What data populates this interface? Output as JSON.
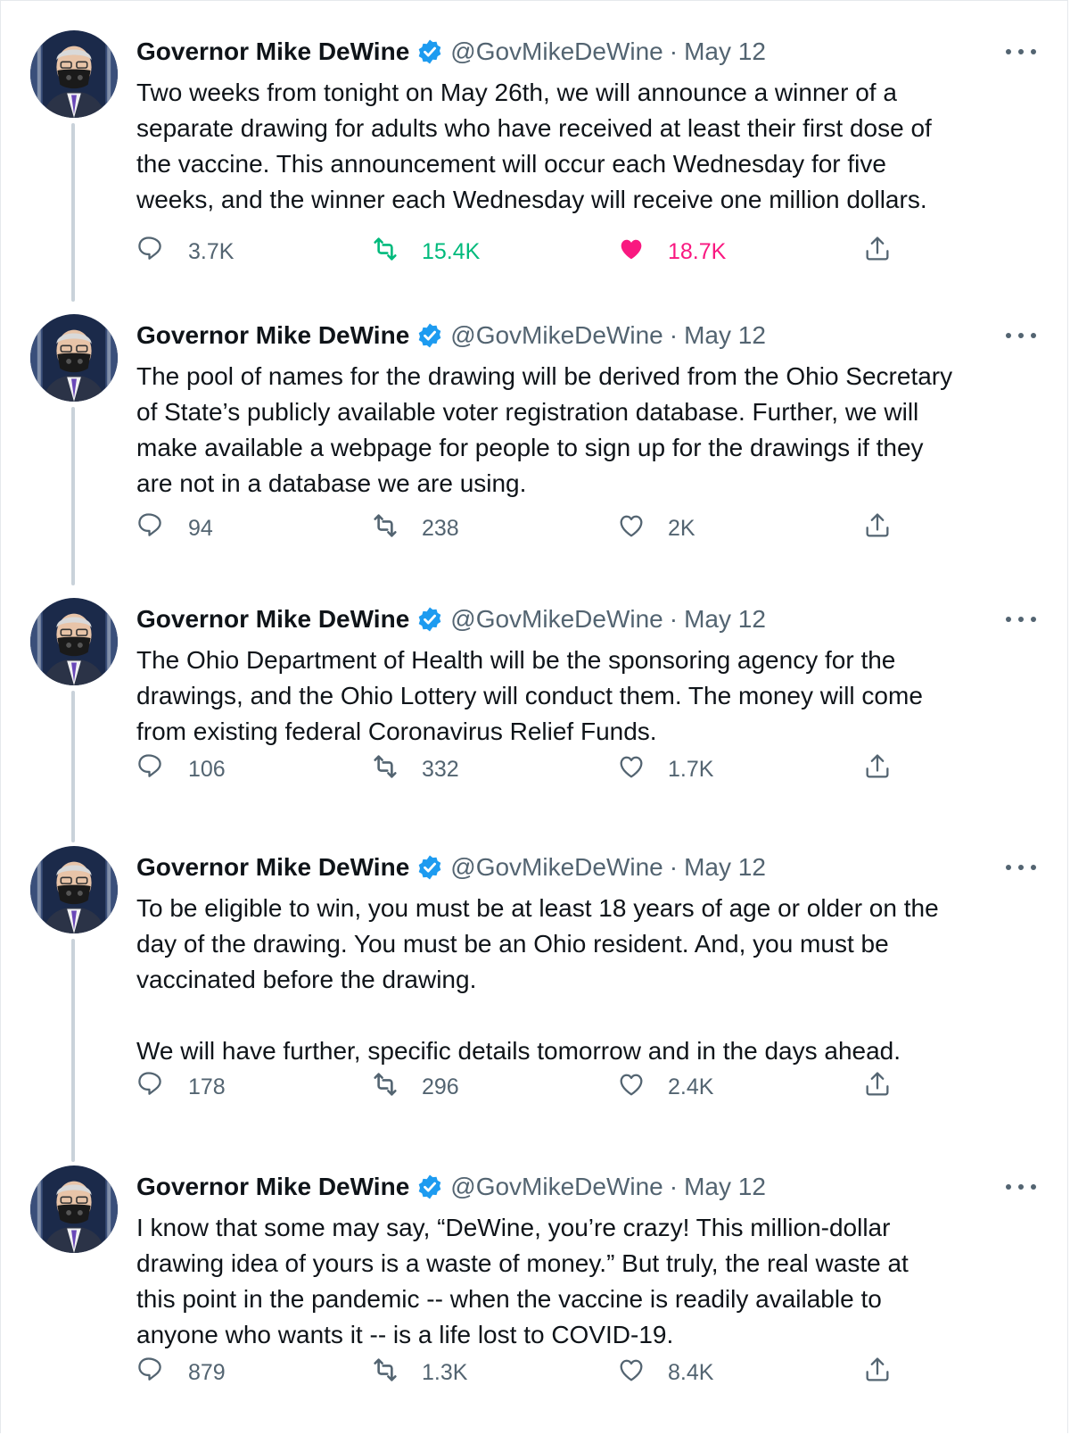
{
  "author": {
    "name": "Governor Mike DeWine",
    "handle": "@GovMikeDeWine",
    "separator": "·"
  },
  "colors": {
    "verified": "#1d9bf0",
    "retweeted": "#00ba7c",
    "liked": "#f91880",
    "muted": "#536471",
    "thread_line": "#c9d2da"
  },
  "tweets": [
    {
      "date": "May 12",
      "text": "Two weeks from tonight on May 26th, we will announce a winner of a\nseparate drawing for adults who have received at least their first dose of\nthe vaccine.  This announcement will occur each Wednesday for five\nweeks, and the winner each Wednesday will receive one million dollars.",
      "replies": "3.7K",
      "retweets": "15.4K",
      "likes": "18.7K",
      "retweeted": true,
      "liked": true
    },
    {
      "date": "May 12",
      "text": "The pool of names for the drawing will be derived from the Ohio Secretary\nof State’s publicly available voter registration database.  Further, we will\nmake available a webpage for people to sign up for the drawings if they\nare not in a database we are using.",
      "replies": "94",
      "retweets": "238",
      "likes": "2K",
      "retweeted": false,
      "liked": false
    },
    {
      "date": "May 12",
      "text": "The Ohio Department of Health will be the sponsoring agency for the\ndrawings, and the Ohio Lottery will conduct them.  The money will come\nfrom existing federal Coronavirus Relief Funds.",
      "replies": "106",
      "retweets": "332",
      "likes": "1.7K",
      "retweeted": false,
      "liked": false
    },
    {
      "date": "May 12",
      "text": "To be eligible to win, you must be at least 18 years of age or older on the\nday of the drawing.  You must be an Ohio resident.  And, you must be\nvaccinated before the drawing.\n\nWe will have further, specific details tomorrow and in the days ahead.",
      "replies": "178",
      "retweets": "296",
      "likes": "2.4K",
      "retweeted": false,
      "liked": false
    },
    {
      "date": "May 12",
      "text": "I know that some may say, “DeWine, you’re crazy!  This million-dollar\ndrawing idea of yours is a waste of money.”  But truly, the real waste at\nthis point in the pandemic -- when the vaccine is readily available to\nanyone who wants it -- is a life lost to COVID-19.",
      "replies": "879",
      "retweets": "1.3K",
      "likes": "8.4K",
      "retweeted": false,
      "liked": false
    }
  ],
  "icons": {
    "reply": "reply-icon",
    "retweet": "retweet-icon",
    "like": "heart-icon",
    "share": "share-icon",
    "more": "more-icon",
    "verified": "verified-badge-icon"
  }
}
